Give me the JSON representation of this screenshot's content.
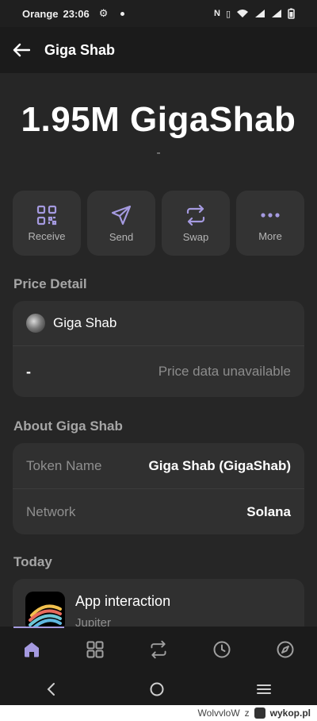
{
  "status_bar": {
    "carrier": "Orange",
    "time": "23:06"
  },
  "header": {
    "title": "Giga Shab"
  },
  "balance": {
    "amount": "1.95M GigaShab",
    "fiat": "-"
  },
  "actions": [
    {
      "label": "Receive",
      "icon": "qr-code-icon"
    },
    {
      "label": "Send",
      "icon": "send-icon"
    },
    {
      "label": "Swap",
      "icon": "swap-icon"
    },
    {
      "label": "More",
      "icon": "more-icon"
    }
  ],
  "price_detail": {
    "section_title": "Price Detail",
    "token_name": "Giga Shab",
    "price": "-",
    "price_status": "Price data unavailable"
  },
  "about": {
    "section_title": "About Giga Shab",
    "rows": [
      {
        "key": "Token Name",
        "value": "Giga Shab (GigaShab)"
      },
      {
        "key": "Network",
        "value": "Solana"
      }
    ]
  },
  "today": {
    "section_title": "Today",
    "items": [
      {
        "title": "App interaction",
        "subtitle": "Jupiter"
      }
    ]
  },
  "tabs": [
    "home-icon",
    "apps-grid-icon",
    "swap-icon",
    "history-icon",
    "explore-icon"
  ],
  "footer": {
    "user": "WolvvloW",
    "separator": "z",
    "site": "wykop.pl"
  },
  "colors": {
    "accent": "#a59ae0",
    "background": "#262626",
    "card": "#303030"
  }
}
